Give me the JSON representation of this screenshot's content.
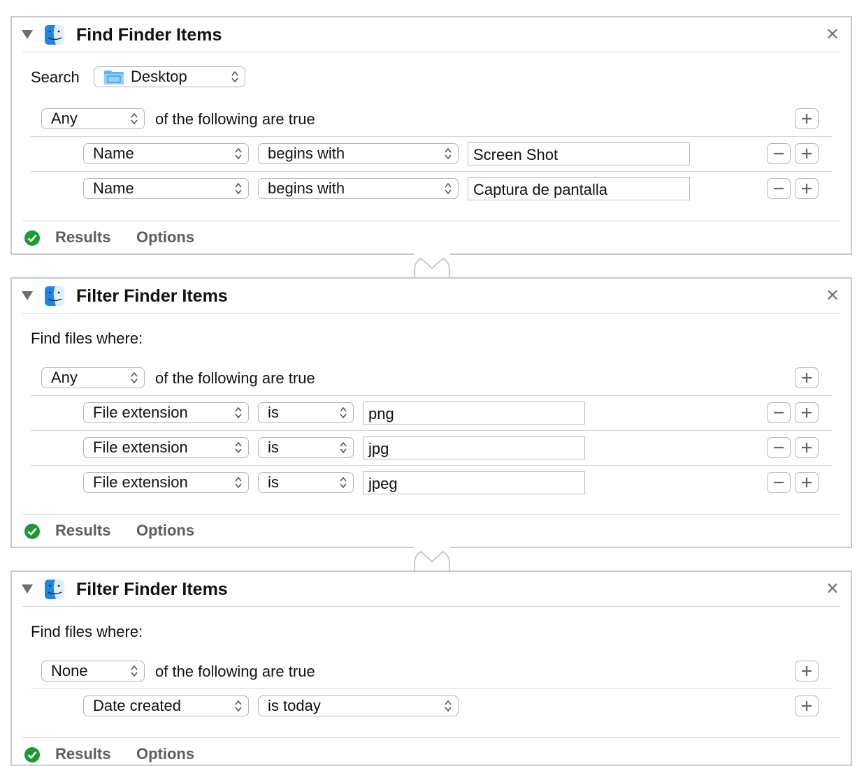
{
  "actions": [
    {
      "title": "Find Finder Items",
      "search_label": "Search",
      "search_location": "Desktop",
      "quantifier": "Any",
      "quantifier_suffix": "of the following are true",
      "conditions": [
        {
          "field": "Name",
          "operator": "begins with",
          "value": "Screen Shot"
        },
        {
          "field": "Name",
          "operator": "begins with",
          "value": "Captura de pantalla"
        }
      ],
      "footer": {
        "results": "Results",
        "options": "Options"
      }
    },
    {
      "title": "Filter Finder Items",
      "subtitle": "Find files where:",
      "quantifier": "Any",
      "quantifier_suffix": "of the following are true",
      "conditions": [
        {
          "field": "File extension",
          "operator": "is",
          "value": "png"
        },
        {
          "field": "File extension",
          "operator": "is",
          "value": "jpg"
        },
        {
          "field": "File extension",
          "operator": "is",
          "value": "jpeg"
        }
      ],
      "footer": {
        "results": "Results",
        "options": "Options"
      }
    },
    {
      "title": "Filter Finder Items",
      "subtitle": "Find files where:",
      "quantifier": "None",
      "quantifier_suffix": "of the following are true",
      "conditions": [
        {
          "field": "Date created",
          "operator": "is today"
        }
      ],
      "footer": {
        "results": "Results",
        "options": "Options"
      }
    }
  ],
  "icons": {
    "collapse": "disclosure-triangle-icon",
    "app": "finder-icon",
    "close": "close-icon",
    "folder": "folder-icon",
    "add": "plus-icon",
    "remove": "minus-icon",
    "status": "check-circle-icon"
  },
  "colors": {
    "status_ok": "#1a9b33",
    "border": "#c9c9c9"
  }
}
